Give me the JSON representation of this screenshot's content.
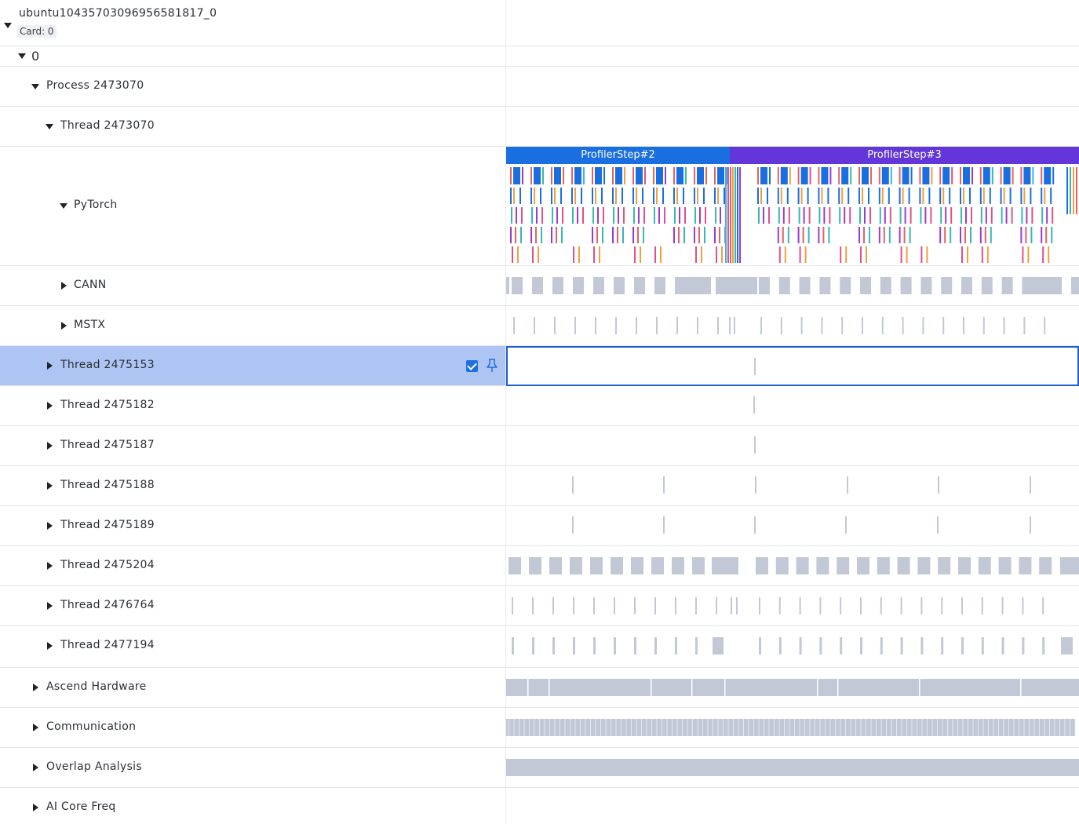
{
  "host": {
    "name": "ubuntu10435703096956581817_0",
    "card": "Card: 0"
  },
  "device": {
    "label": "0"
  },
  "process": {
    "label": "Process 2473070"
  },
  "main_thread": {
    "label": "Thread 2473070"
  },
  "pytorch": {
    "label": "PyTorch"
  },
  "cann": {
    "label": "CANN"
  },
  "mstx": {
    "label": "MSTX"
  },
  "threads": [
    {
      "label": "Thread 2475153",
      "selected": true
    },
    {
      "label": "Thread 2475182",
      "selected": false
    },
    {
      "label": "Thread 2475187",
      "selected": false
    },
    {
      "label": "Thread 2475188",
      "selected": false
    },
    {
      "label": "Thread 2475189",
      "selected": false
    },
    {
      "label": "Thread 2475204",
      "selected": false
    },
    {
      "label": "Thread 2476764",
      "selected": false
    },
    {
      "label": "Thread 2477194",
      "selected": false
    }
  ],
  "groups": [
    {
      "label": "Ascend Hardware"
    },
    {
      "label": "Communication"
    },
    {
      "label": "Overlap Analysis"
    },
    {
      "label": "AI Core Freq"
    }
  ],
  "profiler_steps": [
    {
      "label": "ProfilerStep#2",
      "color": "#1a6fe0"
    },
    {
      "label": "ProfilerStep#3",
      "color": "#6236d8"
    }
  ],
  "colors": {
    "selected_row": "#aec5f4",
    "slice_gray": "#c3c8d6",
    "op_blue": "#1a6fe0",
    "op_orange": "#f0a040",
    "op_pink": "#e0508a",
    "op_purple": "#9a3ad0",
    "op_teal": "#38b8b0",
    "op_red": "#e86060",
    "op_cyan": "#40b0e8"
  }
}
